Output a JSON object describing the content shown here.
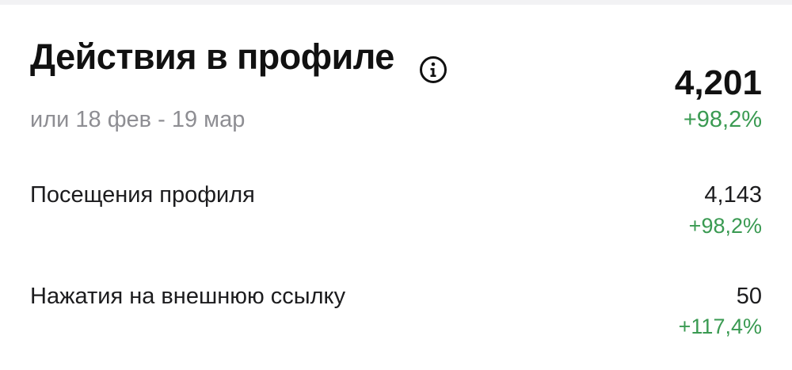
{
  "header": {
    "title": "Действия в профиле",
    "info_icon": "info-icon",
    "date_range": "или 18 фев - 19 мар",
    "total_value": "4,201",
    "total_change": "+98,2%"
  },
  "metrics": [
    {
      "label": "Посещения профиля",
      "value": "4,143",
      "change": "+98,2%"
    },
    {
      "label": "Нажатия на внешнюю ссылку",
      "value": "50",
      "change": "+117,4%"
    }
  ],
  "colors": {
    "positive_change": "#3a9a52",
    "muted_text": "#8e8e93",
    "primary_text": "#111111"
  }
}
